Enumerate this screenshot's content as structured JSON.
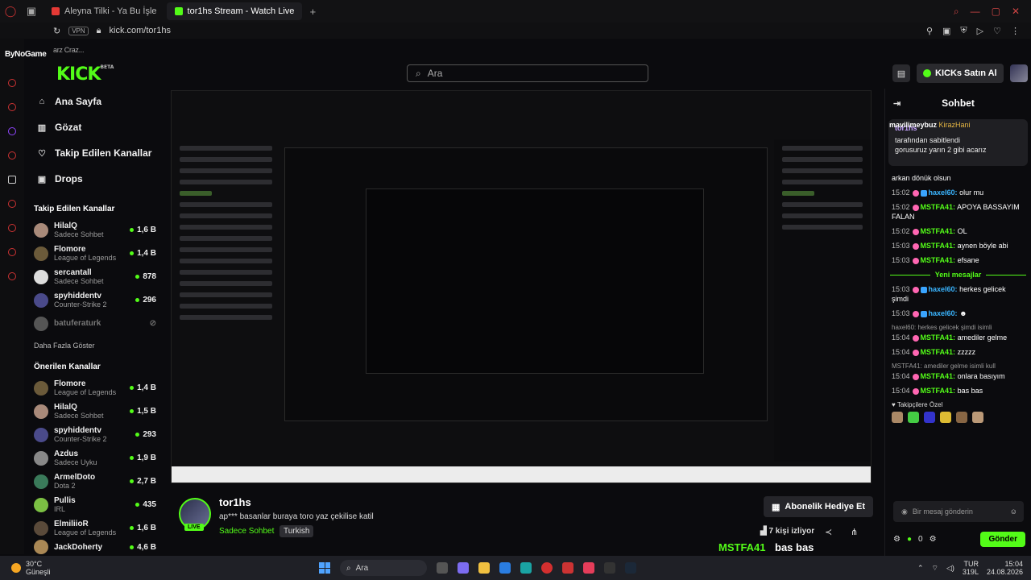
{
  "browser": {
    "tabs": [
      {
        "label": "Aleyna Tilki - Ya Bu İşle",
        "active": false
      },
      {
        "label": "tor1hs Stream - Watch Live",
        "active": true
      }
    ],
    "address": "kick.com/tor1hs",
    "vpn_label": "VPN"
  },
  "overlay_top": {
    "brand": "ByNoGame",
    "sub": "arz  Craz..."
  },
  "header": {
    "logo": "KICK",
    "logo_sup": "BETA",
    "search_placeholder": "Ara",
    "kicks_label": "KICKs Satın Al"
  },
  "sidebar": {
    "nav": [
      {
        "label": "Ana Sayfa",
        "icon": "home-icon"
      },
      {
        "label": "Gözat",
        "icon": "browse-icon"
      },
      {
        "label": "Takip Edilen Kanallar",
        "icon": "heart-icon"
      },
      {
        "label": "Drops",
        "icon": "drops-icon"
      }
    ],
    "followed_title": "Takip Edilen Kanallar",
    "followed": [
      {
        "name": "HilalQ",
        "category": "Sadece Sohbet",
        "viewers": "1,6 B"
      },
      {
        "name": "Flomore",
        "category": "League of Legends",
        "viewers": "1,4 B"
      },
      {
        "name": "sercantall",
        "category": "Sadece Sohbet",
        "viewers": "878"
      },
      {
        "name": "spyhiddentv",
        "category": "Counter-Strike 2",
        "viewers": "296"
      },
      {
        "name": "batuferaturk",
        "category": "",
        "viewers": ""
      }
    ],
    "show_more": "Daha Fazla Göster",
    "recommended_title": "Önerilen Kanallar",
    "recommended": [
      {
        "name": "Flomore",
        "category": "League of Legends",
        "viewers": "1,4 B"
      },
      {
        "name": "HilalQ",
        "category": "Sadece Sohbet",
        "viewers": "1,5 B"
      },
      {
        "name": "spyhiddentv",
        "category": "Counter-Strike 2",
        "viewers": "293"
      },
      {
        "name": "Azdus",
        "category": "Sadece Uyku",
        "viewers": "1,9 B"
      },
      {
        "name": "ArmelDoto",
        "category": "Dota 2",
        "viewers": "2,7 B"
      },
      {
        "name": "Pullis",
        "category": "IRL",
        "viewers": "435"
      },
      {
        "name": "ElmiliioR",
        "category": "League of Legends",
        "viewers": "1,6 B"
      },
      {
        "name": "JackDoherty",
        "category": "",
        "viewers": "4,6 B"
      }
    ]
  },
  "stream": {
    "streamer": "tor1hs",
    "title": "ap*** basanlar buraya toro yaz çekilise katil",
    "category": "Sadece Sohbet",
    "tag": "Turkish",
    "live": "LIVE",
    "gift_label": "Abonelik Hediye Et",
    "viewers": "7 kişi izliyor",
    "overlay_user": "MSTFA41",
    "overlay_msg": "bas bas"
  },
  "chat": {
    "title": "Sohbet",
    "top_msg_user": "mavilimeybuz",
    "top_msg_gold": "KirazHani",
    "pinned": {
      "user": "tor1hs",
      "label": "tarafından sabitlendi",
      "text": "gorusuruz yarın 2 gibi acarız"
    },
    "messages": [
      {
        "time": "",
        "user": "",
        "text": "arkan dönük olsun",
        "reply": ""
      },
      {
        "time": "15:02",
        "user": "haxel60:",
        "text": "olur mu",
        "reply": ""
      },
      {
        "time": "15:02",
        "user": "MSTFA41:",
        "text": "APOYA BASSAYIM FALAN",
        "reply": ""
      },
      {
        "time": "15:02",
        "user": "MSTFA41:",
        "text": "OL",
        "reply": ""
      },
      {
        "time": "15:03",
        "user": "MSTFA41:",
        "text": "aynen böyle abi",
        "reply": ""
      },
      {
        "time": "15:03",
        "user": "MSTFA41:",
        "text": "efsane",
        "reply": ""
      }
    ],
    "new_label": "Yeni mesajlar",
    "new_messages": [
      {
        "time": "15:03",
        "user": "haxel60:",
        "text": "herkes gelicek şimdi",
        "reply": ""
      },
      {
        "time": "15:03",
        "user": "haxel60:",
        "text": "",
        "reply": ""
      },
      {
        "time": "15:04",
        "user": "MSTFA41:",
        "text": "amediler gelme",
        "reply": "haxel60: herkes gelicek şimdi isimli"
      },
      {
        "time": "15:04",
        "user": "MSTFA41:",
        "text": "zzzzz",
        "reply": ""
      },
      {
        "time": "15:04",
        "user": "MSTFA41:",
        "text": "onlara basıyım",
        "reply": "MSTFA41: amediler gelme isimli kull"
      },
      {
        "time": "15:04",
        "user": "MSTFA41:",
        "text": "bas bas",
        "reply": ""
      }
    ],
    "subs_label": "Takipçilere Özel",
    "input_placeholder": "Bir mesaj gönderin",
    "points": "0",
    "send": "Gönder"
  },
  "taskbar": {
    "temp": "30°C",
    "weather": "Güneşli",
    "search": "Ara",
    "lang": "TUR",
    "lang2": "319L",
    "time": "15:04",
    "date": "24.08.2026"
  }
}
